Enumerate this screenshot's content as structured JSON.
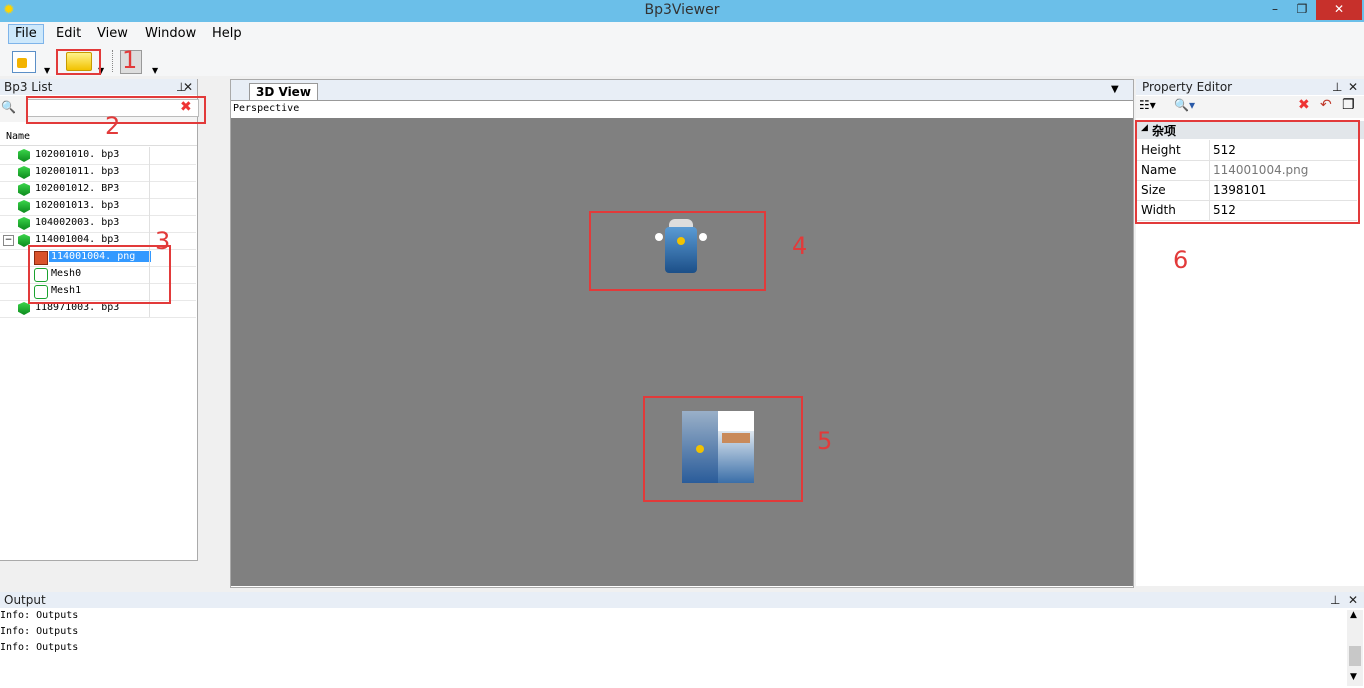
{
  "window": {
    "title": "Bp3Viewer",
    "minimize_icon": "minimize-icon",
    "restore_icon": "restore-icon",
    "close_icon": "close-icon"
  },
  "menu": {
    "items": [
      "File",
      "Edit",
      "View",
      "Window",
      "Help"
    ]
  },
  "annotations": {
    "n1": "1",
    "n2": "2",
    "n3": "3",
    "n4": "4",
    "n5": "5",
    "n6": "6",
    "color": "#e23a3a"
  },
  "bp3_list": {
    "title": "Bp3 List",
    "search_value": "",
    "column_name": "Name",
    "items": [
      {
        "label": "102001010. bp3",
        "icon": "green-gem-icon"
      },
      {
        "label": "102001011. bp3",
        "icon": "green-gem-icon"
      },
      {
        "label": "102001012. BP3",
        "icon": "green-gem-icon"
      },
      {
        "label": "102001013. bp3",
        "icon": "green-gem-icon"
      },
      {
        "label": "104002003. bp3",
        "icon": "green-gem-icon"
      },
      {
        "label": "114001004. bp3",
        "icon": "green-gem-icon",
        "expanded": true
      },
      {
        "label": "114001004. png",
        "icon": "texture-icon",
        "child": true,
        "selected": true
      },
      {
        "label": "Mesh0",
        "icon": "mesh-icon",
        "child": true
      },
      {
        "label": "Mesh1",
        "icon": "mesh-icon",
        "child": true
      },
      {
        "label": "118971003. bp3",
        "icon": "green-gem-icon"
      }
    ]
  },
  "viewport": {
    "tab": "3D View",
    "mode": "Perspective",
    "background": "#808080"
  },
  "property_editor": {
    "title": "Property Editor",
    "category": "杂项",
    "rows": [
      {
        "key": "Height",
        "value": "512"
      },
      {
        "key": "Name",
        "value": "114001004.png"
      },
      {
        "key": "Size",
        "value": "1398101"
      },
      {
        "key": "Width",
        "value": "512"
      }
    ]
  },
  "output": {
    "title": "Output",
    "lines": [
      "Info: Outputs",
      "Info: Outputs",
      "Info: Outputs"
    ]
  }
}
